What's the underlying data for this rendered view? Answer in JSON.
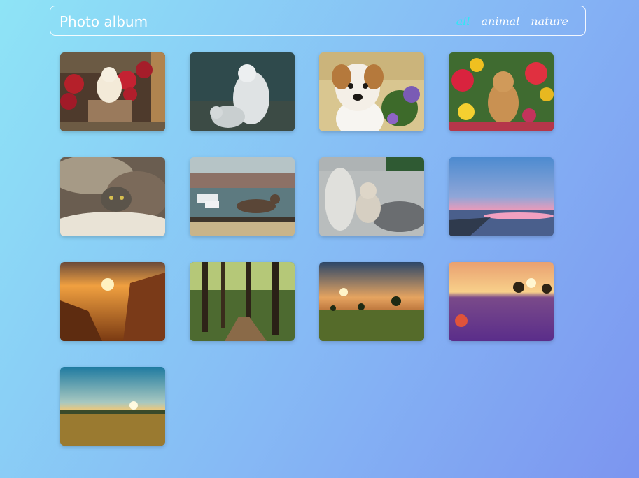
{
  "header": {
    "title": "Photo album",
    "filters": [
      {
        "label": "all",
        "active": true
      },
      {
        "label": "animal",
        "active": false
      },
      {
        "label": "nature",
        "active": false
      }
    ]
  },
  "photos": [
    {
      "subject": "puppy on wooden crate with red flowers",
      "category": "animal"
    },
    {
      "subject": "white wolves in forest",
      "category": "animal"
    },
    {
      "subject": "jack russell puppy with flowers",
      "category": "animal"
    },
    {
      "subject": "golden puppy among flower pots",
      "category": "animal"
    },
    {
      "subject": "cat peeking under blanket",
      "category": "animal"
    },
    {
      "subject": "cat walking by harbor",
      "category": "animal"
    },
    {
      "subject": "kitten on sofa",
      "category": "animal"
    },
    {
      "subject": "pink sunset over sea",
      "category": "nature"
    },
    {
      "subject": "mountain valley sunrise",
      "category": "nature"
    },
    {
      "subject": "forest path",
      "category": "nature"
    },
    {
      "subject": "sunrise over meadow with trees",
      "category": "nature"
    },
    {
      "subject": "lavender field at sunset",
      "category": "nature"
    },
    {
      "subject": "sunset over golden field",
      "category": "nature"
    }
  ],
  "colors": {
    "active_filter": "#2ee8f5",
    "text": "#ffffff"
  }
}
